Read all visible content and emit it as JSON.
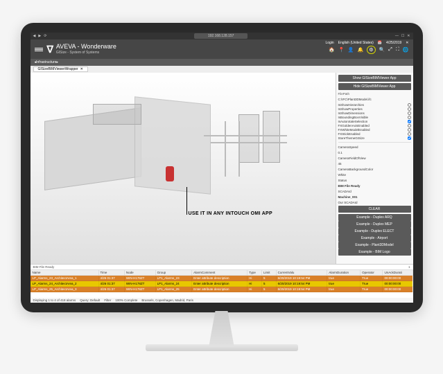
{
  "titlebar": {
    "address": "192.168.128.157",
    "login": "Login",
    "locale": "English (United States)",
    "date": "4/25/2019"
  },
  "header": {
    "brand": "AVEVA - Wonderware",
    "subtitle": "GISize - System of Systems",
    "icons": [
      "🏠",
      "📍",
      "👤",
      "🔔",
      "⚙",
      "🔍",
      "⤢",
      "⛶",
      "🌐"
    ]
  },
  "breadcrumb": {
    "path": "Infrastructure"
  },
  "tabs": {
    "active": "GISizeBIMViewerWrapper"
  },
  "callout": {
    "text": "USE IT IN ANY INTOUCH OMI APP"
  },
  "sidebar": {
    "btn_show": "Show GISizeBIMViewer App",
    "btn_hide": "Hide GISizeBIMViewer App",
    "filepath_label": "FilePath",
    "filepath_value": "C:\\IFC\\Plant3DModel.ifc",
    "props": [
      {
        "label": "IsShowHierarchies",
        "checked": false
      },
      {
        "label": "IsShowProperties",
        "checked": false
      },
      {
        "label": "IsShowDimensions",
        "checked": false
      },
      {
        "label": "IsBoundingBoxVisible",
        "checked": false
      },
      {
        "label": "IsAutorotateSelection",
        "checked": true
      },
      {
        "label": "FXGoldenAxisEnabled",
        "checked": false
      },
      {
        "label": "FXWhiteModelEnabled",
        "checked": false
      },
      {
        "label": "FXStickEnabled",
        "checked": false
      },
      {
        "label": "StoreThemeGISize",
        "checked": true
      }
    ],
    "cam_speed_label": "CameraSpeed",
    "cam_speed_value": "0.1",
    "cam_fov_label": "CameraFieldOfView",
    "cam_fov_value": "45",
    "cam_bg_label": "CameraBackgroundColor",
    "cam_bg_value": "White",
    "status_label": "Status",
    "status_value": "BIM File Ready",
    "scadaid_label": "SCADAId",
    "scadaid_value": "Machine_001",
    "scadaids_label": "Our SCADAId",
    "btn_clear": "CLEAR",
    "examples": [
      "Example - Duplex ARQ",
      "Example - Duplex MEP",
      "Example - Duplex ELECT",
      "Example - Airport",
      "Example - Plant3DModel",
      "Example - BIM Logo"
    ]
  },
  "alarms": {
    "status": "BIM File Ready",
    "page": "1",
    "columns": [
      "Name",
      "Time",
      "Node",
      "Group",
      "AlarmComment",
      "Type",
      "Limit",
      "CurrentValu",
      "AlarmDuration",
      "Operator",
      "UnAckDurati"
    ],
    "rows": [
      {
        "cls": "row-critical",
        "cells": [
          "LP_Alarms_23_ArchitectArea_1",
          "4/26 01:37",
          "WIN-H178ZT",
          "LP1_Alarms_23",
          "Enter attribute description",
          "Hi",
          "5",
          "6/20/2019 10:19:54 PM",
          "true",
          "True",
          "00:00:00:00"
        ]
      },
      {
        "cls": "row-warn",
        "cells": [
          "LP_Alarms_24_ArchitectArea_2",
          "4/26 01:37",
          "WIN-H178ZT",
          "LP1_Alarms_24",
          "Enter attribute description",
          "Hi",
          "5",
          "6/20/2019 10:19:54 PM",
          "true",
          "True",
          "00:00:00:00"
        ]
      },
      {
        "cls": "row-critical",
        "cells": [
          "LP_Alarms_25_ArchitectArea_3",
          "4/26 01:37",
          "WIN-H178ZT",
          "LP1_Alarms_25",
          "Enter attribute description",
          "Hi",
          "5",
          "6/20/2019 10:19:54 PM",
          "true",
          "True",
          "00:00:00:00"
        ]
      }
    ],
    "footer_display": "Displaying 1 to 4 of 418 alarms",
    "footer_query": "Query: Default",
    "footer_filter": "Filter",
    "footer_complete": "100% Complete",
    "footer_tz": "Brussels, Copenhagen, Madrid, Paris"
  }
}
